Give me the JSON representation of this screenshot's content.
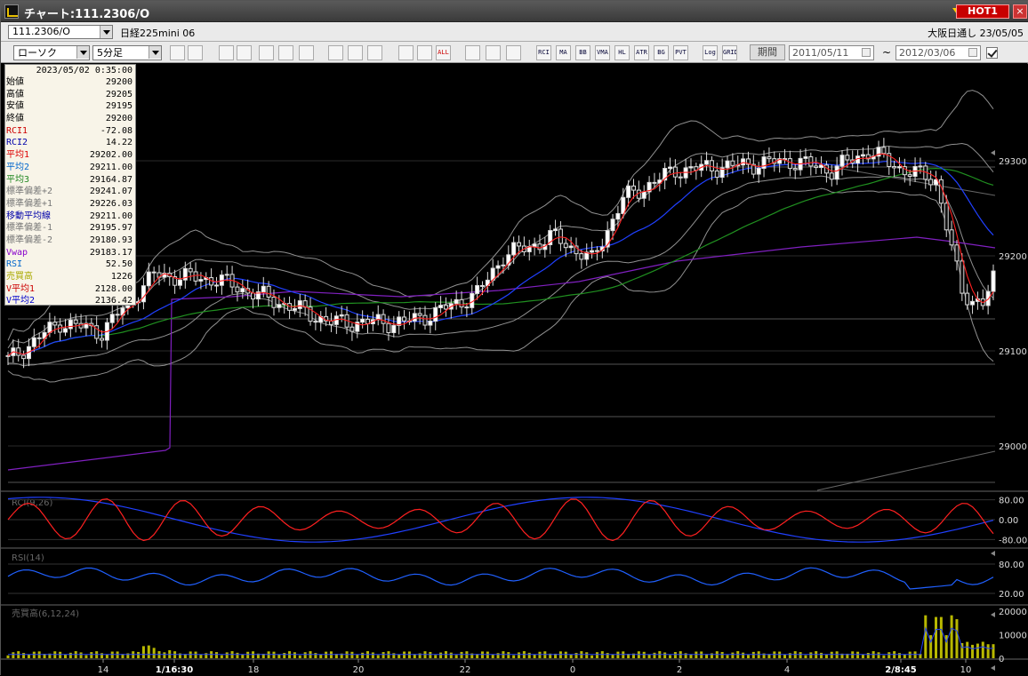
{
  "window": {
    "title": "チャート:111.2306/O",
    "hot_label": "HOT1"
  },
  "bar1": {
    "symbol": "111.2306/O",
    "instrument": "日経225mini 06",
    "exchange": "大阪日通し 23/05/05"
  },
  "bar2": {
    "chart_type": "ローソク",
    "interval": "5分足",
    "period_label": "期間",
    "date_from": "2011/05/11",
    "date_to": "2012/03/06",
    "range_separator": "~",
    "icons": [
      "zoom-icon",
      "cursor-icon",
      "down-icon",
      "search-icon",
      "chart-icon",
      "arrow-icon",
      "warning-icon",
      "pen-icon",
      "select-icon",
      "undo-icon",
      "candle-icon",
      "candle2-icon",
      "all-icon",
      "settings-icon",
      "tool-icon",
      "color-icon"
    ],
    "indicator_buttons": [
      "RCI",
      "MA",
      "BB",
      "VMA",
      "HL",
      "ATR",
      "BG",
      "PVT",
      "Log",
      "GRID"
    ],
    "all_label": "ALL"
  },
  "info_panel": {
    "datetime": "2023/05/02 0:35:00",
    "rows": [
      {
        "label": "始値",
        "value": "29200",
        "color": "#000000"
      },
      {
        "label": "高値",
        "value": "29205",
        "color": "#000000"
      },
      {
        "label": "安値",
        "value": "29195",
        "color": "#000000"
      },
      {
        "label": "終値",
        "value": "29200",
        "color": "#000000"
      },
      {
        "label": "RCI1",
        "value": "-72.08",
        "color": "#cc0000"
      },
      {
        "label": "RCI2",
        "value": "14.22",
        "color": "#0000aa"
      },
      {
        "label": "平均1",
        "value": "29202.00",
        "color": "#dd0000"
      },
      {
        "label": "平均2",
        "value": "29211.00",
        "color": "#0066cc"
      },
      {
        "label": "平均3",
        "value": "29164.87",
        "color": "#228822"
      },
      {
        "label": "標準偏差+2",
        "value": "29241.07",
        "color": "#777777"
      },
      {
        "label": "標準偏差+1",
        "value": "29226.03",
        "color": "#777777"
      },
      {
        "label": "移動平均線",
        "value": "29211.00",
        "color": "#0000aa"
      },
      {
        "label": "標準偏差-1",
        "value": "29195.97",
        "color": "#777777"
      },
      {
        "label": "標準偏差-2",
        "value": "29180.93",
        "color": "#777777"
      },
      {
        "label": "Vwap",
        "value": "29183.17",
        "color": "#8800cc"
      },
      {
        "label": "RSI",
        "value": "52.50",
        "color": "#0066cc"
      },
      {
        "label": "売買高",
        "value": "1226",
        "color": "#aaaa00"
      },
      {
        "label": "V平均1",
        "value": "2128.00",
        "color": "#cc0000"
      },
      {
        "label": "V平均2",
        "value": "2136.42",
        "color": "#0000cc"
      }
    ]
  },
  "price_axis": [
    "29300",
    "29200",
    "29100",
    "29000"
  ],
  "rci_panel": {
    "title": "RCI(9,26)",
    "levels": [
      "80.00",
      "0.00",
      "-80.00"
    ]
  },
  "rsi_panel": {
    "title": "RSI(14)",
    "levels": [
      "80.00",
      "20.00"
    ]
  },
  "volume_panel": {
    "title": "売買高(6,12,24)",
    "levels": [
      "20000",
      "10000",
      "0"
    ]
  },
  "x_axis": [
    "14",
    "1/16:30",
    "18",
    "20",
    "22",
    "0",
    "2",
    "4",
    "2/8:45",
    "10"
  ],
  "colors": {
    "ma1": "#ff2020",
    "ma2": "#2040ff",
    "ma3": "#209020",
    "vwap": "#8020c0",
    "band": "#909090",
    "rci1": "#ff2020",
    "rci2": "#2040ff",
    "rsi": "#2060ff",
    "volume": "#b8b800"
  }
}
